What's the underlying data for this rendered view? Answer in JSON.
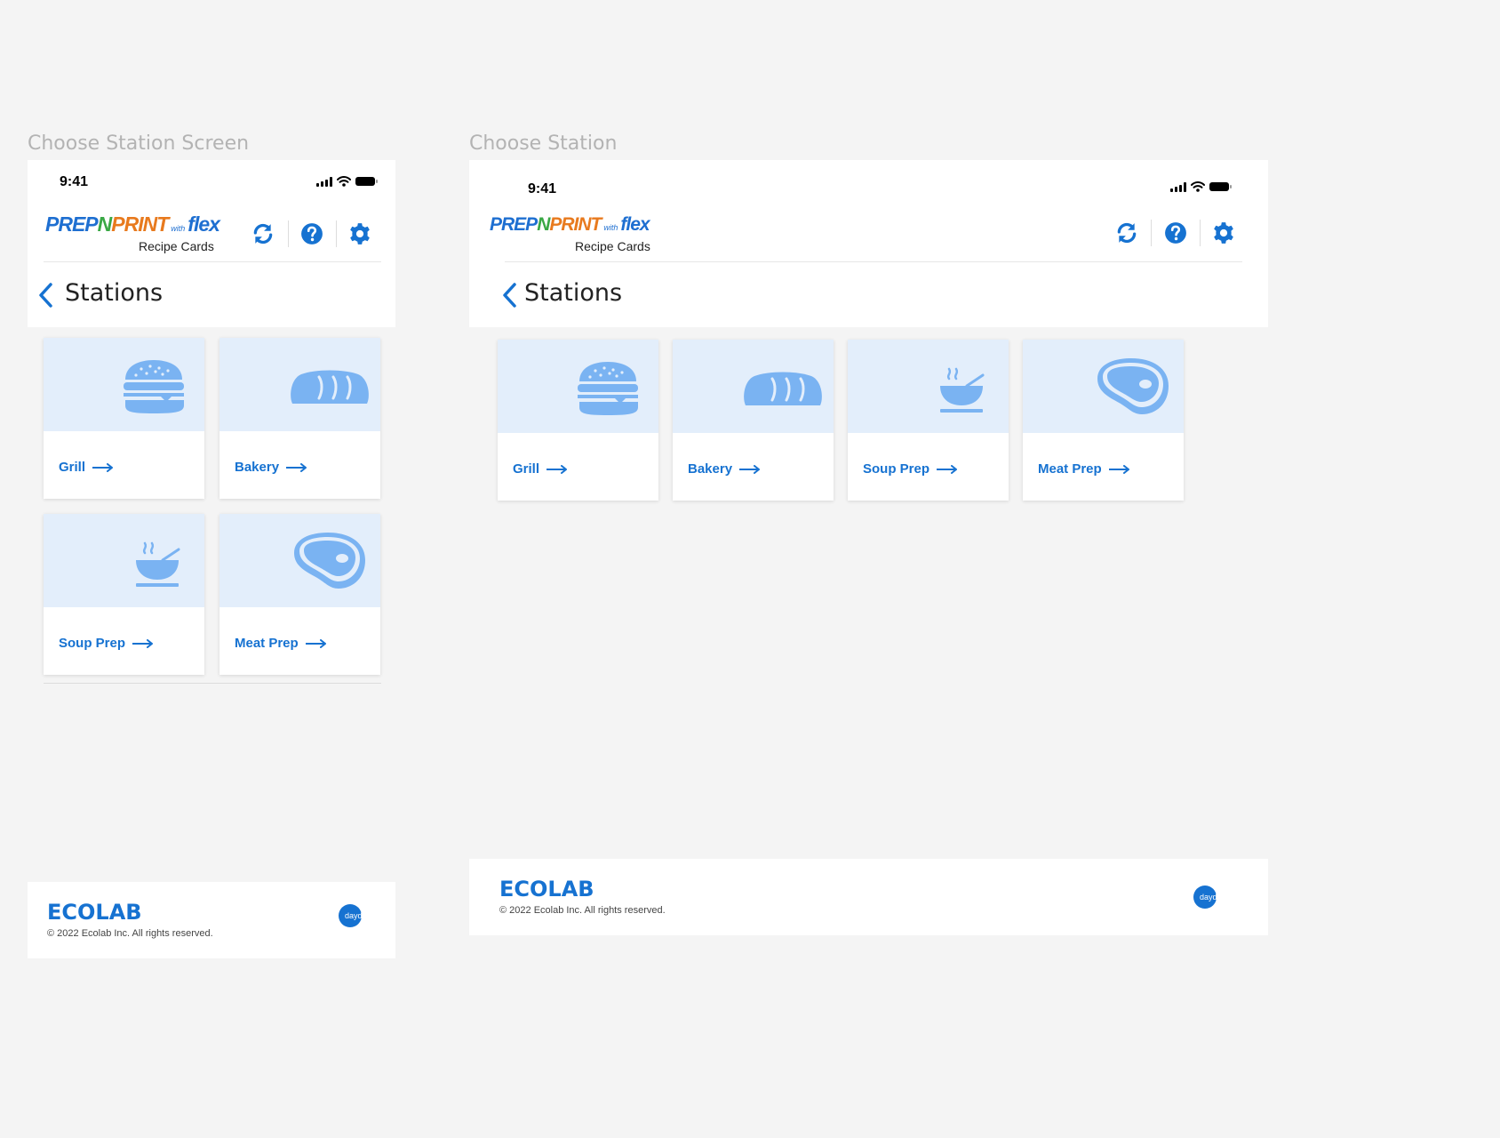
{
  "frames": [
    {
      "label": "Choose Station Screen",
      "status_time": "9:41",
      "logo": {
        "prep": "PREP",
        "n": "N",
        "print": "PRINT",
        "with": "with",
        "flex": "flex"
      },
      "logo_subtitle": "Recipe Cards",
      "page_title": "Stations",
      "stations": [
        {
          "label": "Grill",
          "icon": "burger-icon"
        },
        {
          "label": "Bakery",
          "icon": "bread-icon"
        },
        {
          "label": "Soup Prep",
          "icon": "soup-bowl-icon"
        },
        {
          "label": "Meat Prep",
          "icon": "steak-icon"
        }
      ],
      "footer": {
        "brand": "ECOLAB",
        "copyright": "© 2022 Ecolab Inc. All rights reserved.",
        "daydots": "daydots"
      }
    },
    {
      "label": "Choose Station",
      "status_time": "9:41",
      "logo": {
        "prep": "PREP",
        "n": "N",
        "print": "PRINT",
        "with": "with",
        "flex": "flex"
      },
      "logo_subtitle": "Recipe Cards",
      "page_title": "Stations",
      "stations": [
        {
          "label": "Grill",
          "icon": "burger-icon"
        },
        {
          "label": "Bakery",
          "icon": "bread-icon"
        },
        {
          "label": "Soup Prep",
          "icon": "soup-bowl-icon"
        },
        {
          "label": "Meat Prep",
          "icon": "steak-icon"
        }
      ],
      "footer": {
        "brand": "ECOLAB",
        "copyright": "© 2022 Ecolab Inc. All rights reserved.",
        "daydots": "daydots"
      }
    }
  ],
  "colors": {
    "accent": "#1672d1",
    "icon_fill": "#7ab3f2",
    "card_image_bg": "#e3eefb",
    "page_bg": "#f4f4f4"
  }
}
